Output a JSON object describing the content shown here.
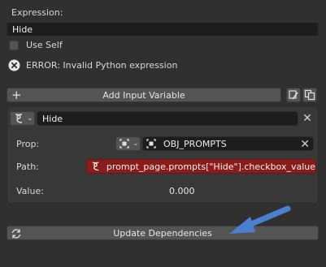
{
  "expression": {
    "label": "Expression:",
    "value": "Hide"
  },
  "use_self": {
    "label": "Use Self",
    "checked": false
  },
  "error": {
    "message": "ERROR: Invalid Python expression",
    "icon": "error-x-circle-icon"
  },
  "add_input_variable": {
    "label": "Add Input Variable",
    "plus_icon": "plus-icon",
    "extra_icons": [
      "eyedropper-icon",
      "copy-icon"
    ]
  },
  "variable": {
    "type_icon": "driver-variable-icon",
    "name": "Hide",
    "prop_label": "Prop:",
    "prop_value": "OBJ_PROMPTS",
    "path_label": "Path:",
    "path_value": "prompt_page.prompts[\"Hide\"].checkbox_value",
    "value_label": "Value:",
    "value": "0.000"
  },
  "update_dependencies": {
    "label": "Update Dependencies",
    "icon": "refresh-icon"
  },
  "annotation": {
    "arrow_color": "#4a7fd0"
  }
}
